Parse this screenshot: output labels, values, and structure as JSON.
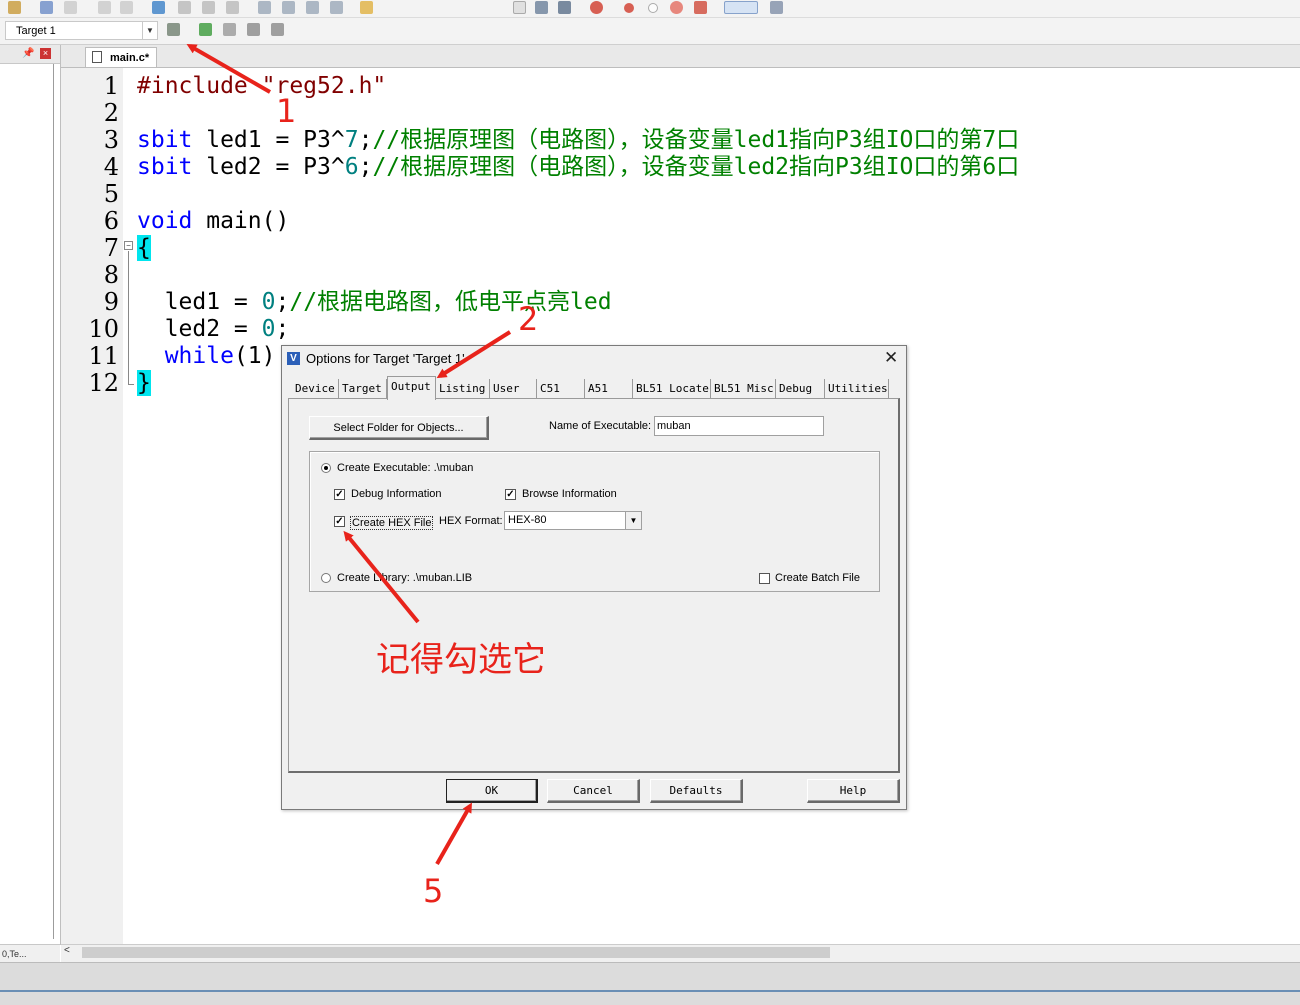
{
  "toolbar": {
    "target_name": "Target 1"
  },
  "left_panel": {
    "bottom_label": "Te..."
  },
  "editor": {
    "tab_label": "main.c*",
    "line_numbers": [
      "1",
      "2",
      "3",
      "4",
      "5",
      "6",
      "7",
      "8",
      "9",
      "10",
      "11",
      "12"
    ],
    "lines": {
      "l1_pre": "#include",
      "l1_str": "\"reg52.h\"",
      "l3_kw": "sbit",
      "l3_code": " led1 = P3^",
      "l3_num": "7",
      "l3_semi": ";",
      "l3_cmt": "//根据原理图（电路图），设备变量led1指向P3组IO口的第7口",
      "l4_kw": "sbit",
      "l4_code": " led2 = P3^",
      "l4_num": "6",
      "l4_semi": ";",
      "l4_cmt": "//根据原理图（电路图），设备变量led2指向P3组IO口的第6口",
      "l6_kw": "void",
      "l6_code": " main()",
      "l7_brace": "{",
      "l9_code": "  led1 = ",
      "l9_num": "0",
      "l9_semi": ";",
      "l9_cmt": "//根据电路图，低电平点亮led",
      "l10_code": "  led2 = ",
      "l10_num": "0",
      "l10_semi": ";",
      "l11_kw": "  while",
      "l11_code": "(1)",
      "l12_brace": "}"
    }
  },
  "dialog": {
    "title": "Options for Target 'Target 1'",
    "tabs": [
      "Device",
      "Target",
      "Output",
      "Listing",
      "User",
      "C51",
      "A51",
      "BL51 Locate",
      "BL51 Misc",
      "Debug",
      "Utilities"
    ],
    "active_tab": "Output",
    "select_folder_button": "Select Folder for Objects...",
    "name_of_executable_label": "Name of Executable:",
    "name_of_executable_value": "muban",
    "create_executable_label": "Create Executable:  .\\muban",
    "debug_information_label": "Debug Information",
    "browse_information_label": "Browse Information",
    "create_hex_label": "Create HEX File",
    "hex_format_label": "HEX Format:",
    "hex_format_value": "HEX-80",
    "create_library_label": "Create Library:  .\\muban.LIB",
    "create_batch_label": "Create Batch File",
    "buttons": {
      "ok": "OK",
      "cancel": "Cancel",
      "defaults": "Defaults",
      "help": "Help"
    },
    "checks": {
      "create_executable": true,
      "debug_information": true,
      "browse_information": true,
      "create_hex": true,
      "create_library": false,
      "create_batch": false
    }
  },
  "annotations": {
    "n1": "1",
    "n2": "2",
    "n5": "5",
    "note": "记得勾选它",
    "color": "#e8231b"
  }
}
